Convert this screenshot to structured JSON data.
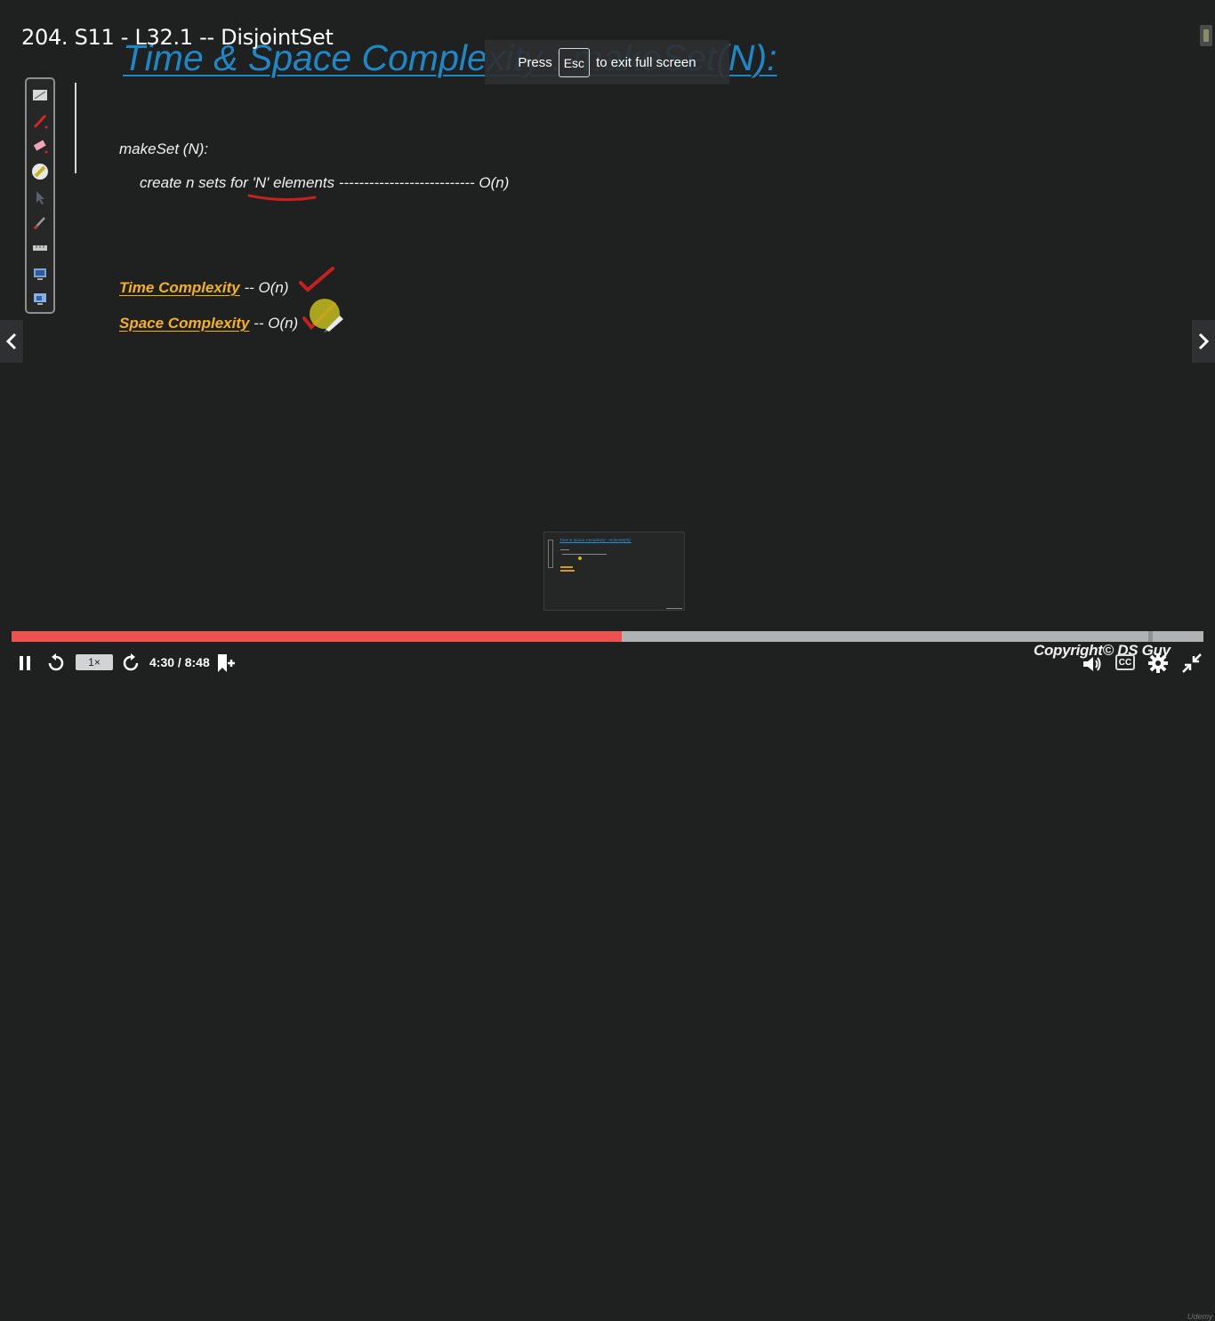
{
  "lecture": {
    "title": "204. S11 - L32.1 -- DisjointSet"
  },
  "slide": {
    "heading": "Time & Space Complexity : makeSet(N):",
    "make_set_label": "makeSet (N):",
    "create_line_prefix": "create n sets for ",
    "create_line_highlight": "'N' elements",
    "create_line_dashes": " --------------------------- ",
    "create_line_result": "O(n)",
    "time_label": "Time Complexity",
    "time_value": " -- O(n)",
    "space_label": "Space Complexity",
    "space_value": " -- O(n)"
  },
  "fullscreen_notice": {
    "press": "Press",
    "key": "Esc",
    "rest": "to exit full screen"
  },
  "pen_toolbar": {
    "tools": [
      "whiteboard-icon",
      "red-pen-icon",
      "eraser-icon",
      "highlighter-icon",
      "pointer-icon",
      "marker-icon",
      "ruler-icon",
      "screen-capture-icon",
      "display-icon"
    ]
  },
  "player": {
    "progress_percent": 51.2,
    "buffered_percent": 100,
    "speed": "1×",
    "current_time": "4:30",
    "separator": " / ",
    "duration": "8:48",
    "copyright": "Copyright© DS Guy",
    "cc_label": "CC",
    "watermark": "Udemy"
  },
  "nav": {
    "prev_icon": "chevron-left-icon",
    "next_icon": "chevron-right-icon"
  },
  "colors": {
    "progress": "#ec5252",
    "heading": "#1e88c7",
    "highlight": "#f6b11e",
    "ink_red": "#c8201f"
  }
}
